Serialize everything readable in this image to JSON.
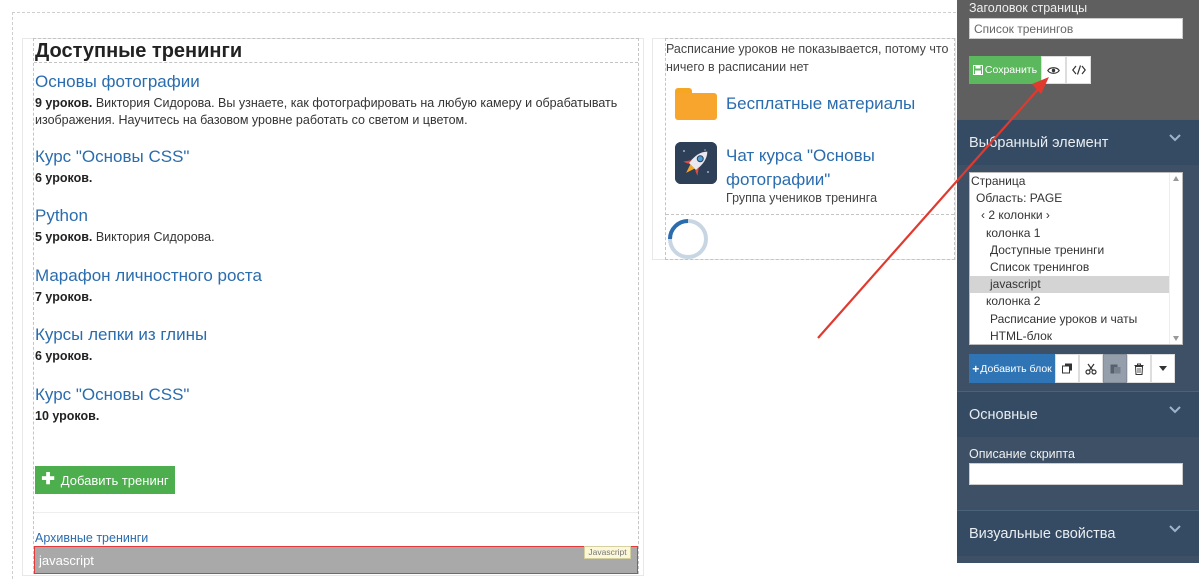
{
  "trainings_list": {
    "title": "Доступные тренинги",
    "items": [
      {
        "name": "Основы фотографии",
        "lessons": "9 уроков.",
        "details": " Виктория Сидорова. Вы узнаете, как фотографировать на любую камеру и обрабатывать изображения. Научитесь на базовом уровне работать со светом и цветом."
      },
      {
        "name": "Курс \"Основы CSS\"",
        "lessons": "6 уроков.",
        "details": ""
      },
      {
        "name": "Python",
        "lessons": "5 уроков.",
        "details": " Виктория Сидорова."
      },
      {
        "name": "Марафон личностного роста",
        "lessons": "7 уроков.",
        "details": ""
      },
      {
        "name": "Курсы лепки из глины",
        "lessons": "6 уроков.",
        "details": ""
      },
      {
        "name": "Курс \"Основы CSS\"",
        "lessons": "10 уроков.",
        "details": ""
      }
    ],
    "add_button": "Добавить тренинг",
    "archive_link": "Архивные тренинги"
  },
  "js_block": {
    "label": "javascript",
    "tag": "Javascript"
  },
  "schedule": {
    "note": "Расписание уроков не показывается, потому что ничего в расписании нет",
    "free_materials": "Бесплатные материалы",
    "chat_title": "Чат курса \"Основы фотографии\"",
    "chat_subtitle": "Группа учеников тренинга"
  },
  "panel": {
    "page_title_label": "Заголовок страницы",
    "page_title_value": "Список тренингов",
    "save_button": "Сохранить",
    "selected_element_header": "Выбранный элемент",
    "tree": [
      "Страница",
      "Область: PAGE",
      "‹ 2 колонки ›",
      "колонка 1",
      "Доступные тренинги",
      "Список тренингов",
      "javascript",
      "колонка 2",
      "Расписание уроков и чаты",
      "HTML-блок"
    ],
    "tree_selected_index": 6,
    "add_block_button": "Добавить блок",
    "basic_header": "Основные",
    "script_description_label": "Описание скрипта",
    "script_description_value": "",
    "visual_header": "Визуальные свойства"
  },
  "colors": {
    "link": "#2a6cae",
    "save_green": "#5cb85c",
    "add_training_green": "#4cae4c",
    "add_block_blue": "#2f74b5",
    "panel_bg": "#3d5066",
    "arrow_red": "#e03a2f",
    "js_block_border": "#e03a3a"
  },
  "icons": {
    "save": "floppy-icon",
    "preview": "eye-icon",
    "code": "code-icon",
    "copy": "copy-icon",
    "cut": "scissors-icon",
    "paste": "paste-icon",
    "delete": "trash-icon",
    "more": "caret-down-icon",
    "folder": "folder-icon",
    "chat": "rocket-icon"
  }
}
